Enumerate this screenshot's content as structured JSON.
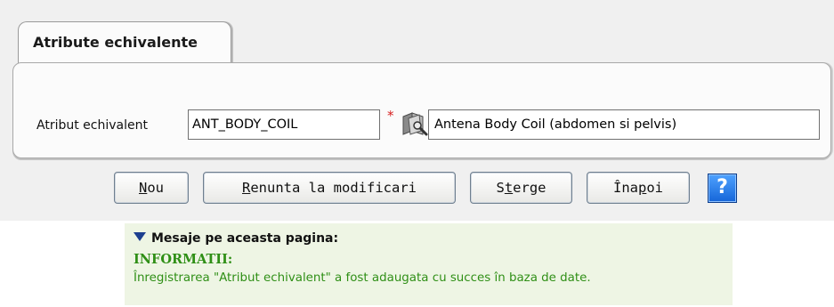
{
  "tab": {
    "label": "Atribute echivalente"
  },
  "form": {
    "field_label": "Atribut echivalent",
    "code_value": "ANT_BODY_COIL",
    "required_mark": "*",
    "description_value": "Antena Body Coil (abdomen si pelvis)",
    "lookup_icon": "folder-search-icon"
  },
  "buttons": {
    "new": {
      "mnemonic": "N",
      "rest": "ou"
    },
    "cancel": {
      "mnemonic": "R",
      "rest": "enunta la modificari"
    },
    "delete": {
      "pre": "S",
      "mnemonic": "t",
      "rest": "erge"
    },
    "back": {
      "pre": "Îna",
      "mnemonic": "p",
      "rest": "oi"
    },
    "help": {
      "label": "?"
    }
  },
  "messages": {
    "header": "Mesaje pe aceasta pagina:",
    "type": "INFORMATII:",
    "text": "Înregistrarea \"Atribut echivalent\" a fost adaugata cu succes în baza de date."
  },
  "colors": {
    "message_green": "#2f8f16",
    "required_red": "#d61f1f",
    "help_blue": "#1565d8"
  }
}
